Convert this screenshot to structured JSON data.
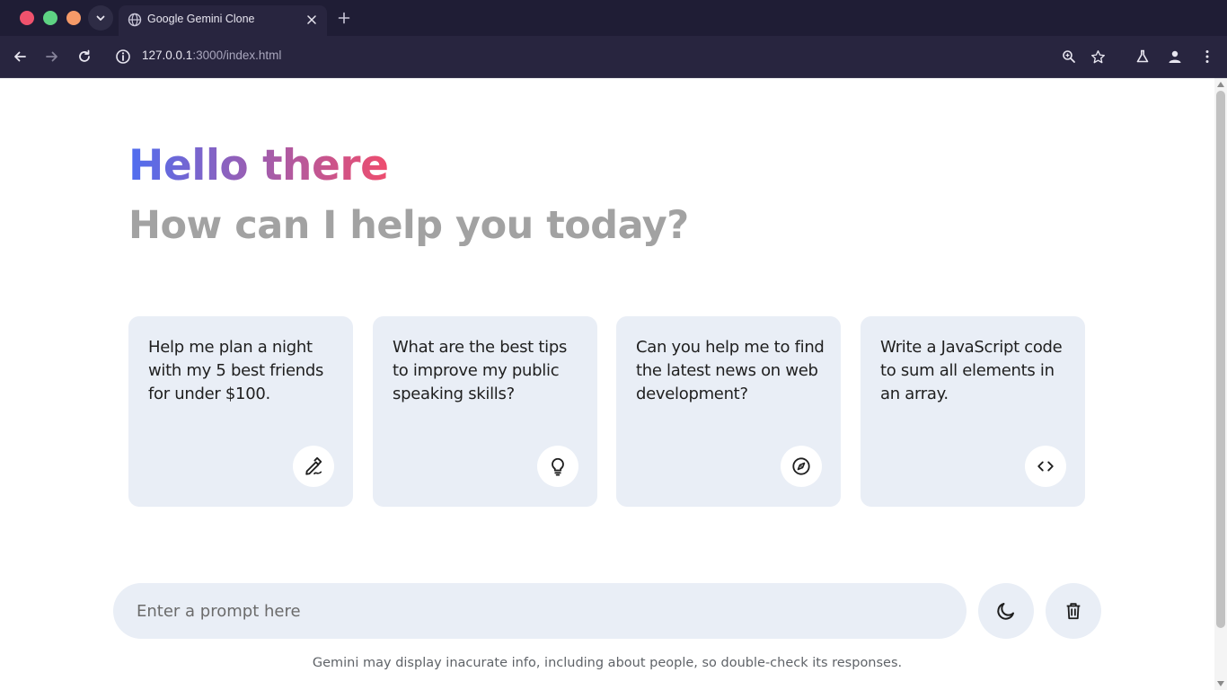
{
  "browser": {
    "tab_title": "Google Gemini Clone",
    "url_host": "127.0.0.1",
    "url_path": ":3000/index.html",
    "colors": {
      "frame": "#1f1d35",
      "toolbar": "#28253f",
      "close": "#f0526d",
      "minimize": "#5ed383",
      "maximize": "#f59a68"
    }
  },
  "header": {
    "title": "Hello there",
    "subtitle": "How can I help you today?",
    "title_gradient": [
      "#4f6ef0",
      "#ee4d6e"
    ]
  },
  "suggestions": [
    {
      "text": "Help me plan a night with my 5 best friends for under $100.",
      "icon": "draw-icon"
    },
    {
      "text": "What are the best tips to improve my public speaking skills?",
      "icon": "lightbulb-icon"
    },
    {
      "text": "Can you help me to find the latest news on web development?",
      "icon": "explore-icon"
    },
    {
      "text": "Write a JavaScript code to sum all elements in an array.",
      "icon": "code-icon"
    }
  ],
  "prompt": {
    "placeholder": "Enter a prompt here",
    "value": ""
  },
  "actions": {
    "theme_icon": "moon-icon",
    "delete_icon": "trash-icon"
  },
  "disclaimer": "Gemini may display inacurate info, including about people, so double-check its responses.",
  "theme": {
    "card_bg": "#e9eef6",
    "subtitle_color": "#a2a2a2"
  }
}
